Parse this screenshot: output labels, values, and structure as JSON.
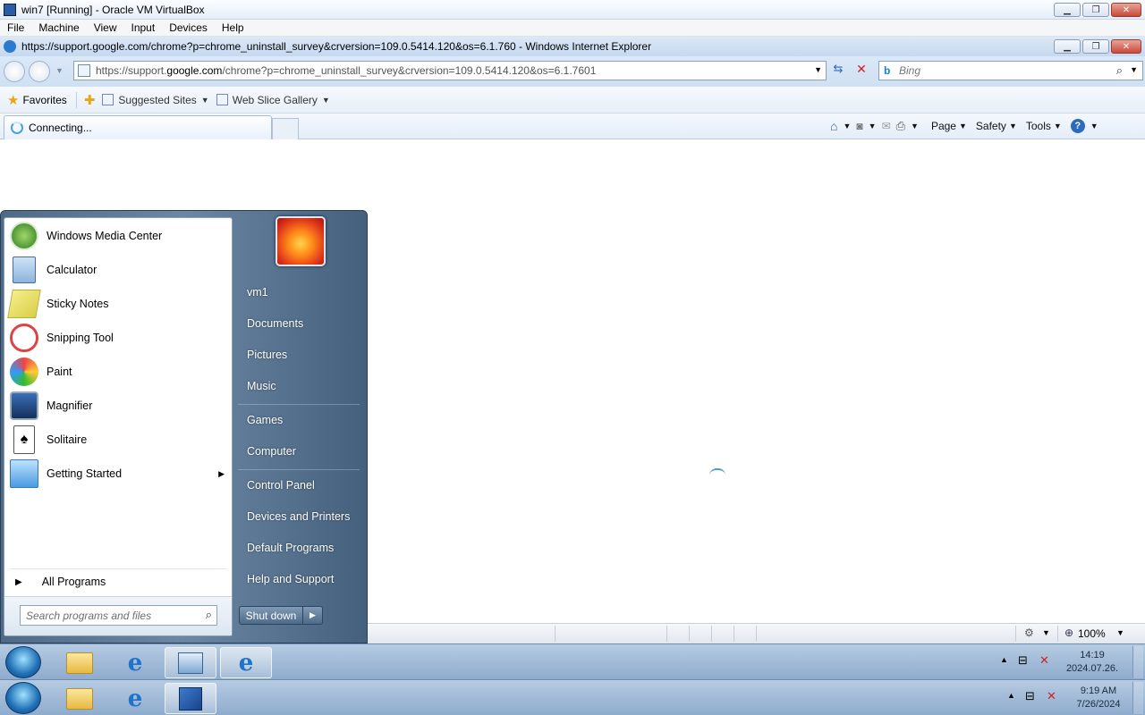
{
  "vbox": {
    "title": "win7 [Running] - Oracle VM VirtualBox",
    "menu": [
      "File",
      "Machine",
      "View",
      "Input",
      "Devices",
      "Help"
    ]
  },
  "ie": {
    "title": "https://support.google.com/chrome?p=chrome_uninstall_survey&crversion=109.0.5414.120&os=6.1.760 - Windows Internet Explorer",
    "url_prefix": "https://support.",
    "url_domain": "google.com",
    "url_suffix": "/chrome?p=chrome_uninstall_survey&crversion=109.0.5414.120&os=6.1.7601",
    "search_placeholder": "Bing",
    "favorites_label": "Favorites",
    "suggested_sites": "Suggested Sites",
    "web_slice_gallery": "Web Slice Gallery",
    "tab_label": "Connecting...",
    "cmd": {
      "page": "Page",
      "safety": "Safety",
      "tools": "Tools"
    },
    "zoom": "100%"
  },
  "start_menu": {
    "programs": [
      {
        "label": "Windows Media Center",
        "icon": "media-center-icon"
      },
      {
        "label": "Calculator",
        "icon": "calculator-icon"
      },
      {
        "label": "Sticky Notes",
        "icon": "sticky-notes-icon"
      },
      {
        "label": "Snipping Tool",
        "icon": "snipping-tool-icon"
      },
      {
        "label": "Paint",
        "icon": "paint-icon"
      },
      {
        "label": "Magnifier",
        "icon": "magnifier-icon"
      },
      {
        "label": "Solitaire",
        "icon": "solitaire-icon"
      },
      {
        "label": "Getting Started",
        "icon": "getting-started-icon"
      }
    ],
    "all_programs": "All Programs",
    "search_placeholder": "Search programs and files",
    "right": {
      "user": "vm1",
      "documents": "Documents",
      "pictures": "Pictures",
      "music": "Music",
      "games": "Games",
      "computer": "Computer",
      "control_panel": "Control Panel",
      "devices_printers": "Devices and Printers",
      "default_programs": "Default Programs",
      "help_support": "Help and Support"
    },
    "shutdown": "Shut down"
  },
  "taskbar_guest": {
    "time": "14:19",
    "date": "2024.07.26."
  },
  "taskbar_host": {
    "time": "9:19 AM",
    "date": "7/26/2024"
  }
}
